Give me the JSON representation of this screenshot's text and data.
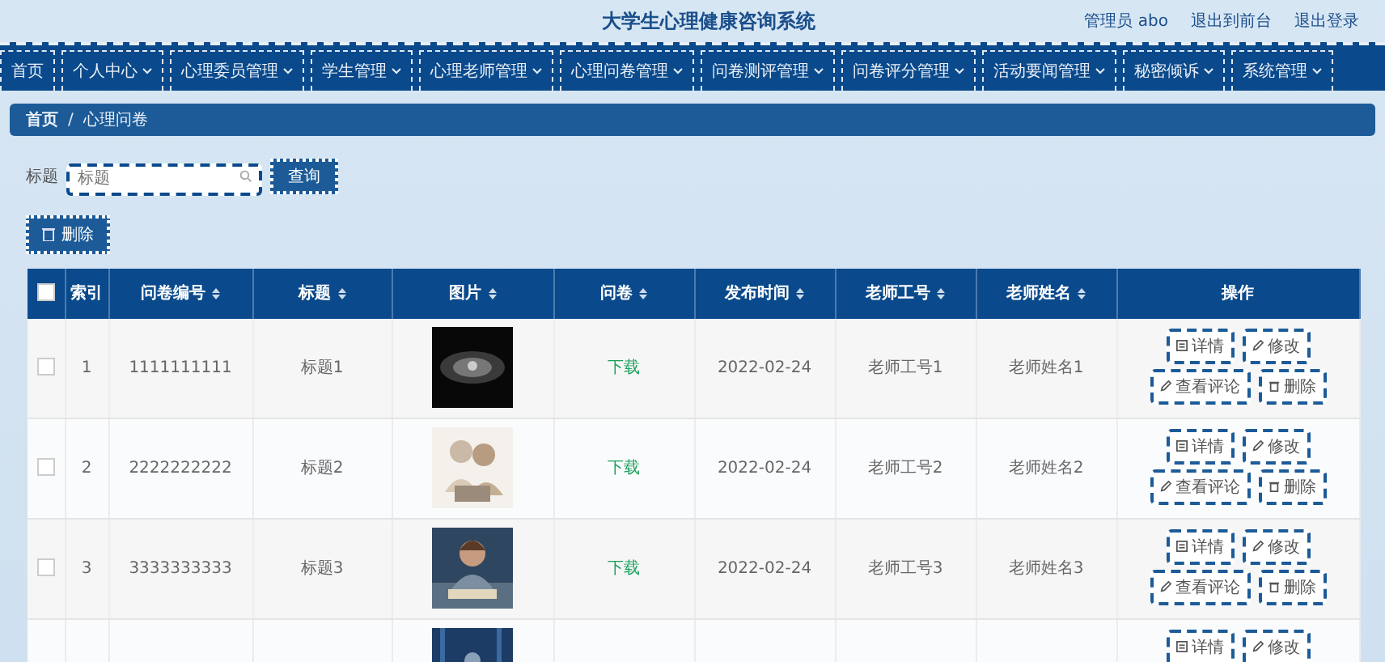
{
  "header": {
    "title": "大学生心理健康咨询系统",
    "user": "管理员 abo",
    "links": [
      "退出到前台",
      "退出登录"
    ]
  },
  "nav": [
    {
      "label": "首页",
      "dropdown": false
    },
    {
      "label": "个人中心",
      "dropdown": true
    },
    {
      "label": "心理委员管理",
      "dropdown": true
    },
    {
      "label": "学生管理",
      "dropdown": true
    },
    {
      "label": "心理老师管理",
      "dropdown": true
    },
    {
      "label": "心理问卷管理",
      "dropdown": true
    },
    {
      "label": "问卷测评管理",
      "dropdown": true
    },
    {
      "label": "问卷评分管理",
      "dropdown": true
    },
    {
      "label": "活动要闻管理",
      "dropdown": true
    },
    {
      "label": "秘密倾诉",
      "dropdown": true
    },
    {
      "label": "系统管理",
      "dropdown": true
    }
  ],
  "breadcrumb": [
    "首页",
    "/",
    "心理问卷"
  ],
  "search": {
    "label": "标题",
    "placeholder": "标题",
    "button": "查询"
  },
  "delete_button": "删除",
  "table": {
    "header_checked": false,
    "columns": [
      {
        "label": "索引",
        "sortable": false
      },
      {
        "label": "问卷编号",
        "sortable": true
      },
      {
        "label": "标题",
        "sortable": true
      },
      {
        "label": "图片",
        "sortable": true
      },
      {
        "label": "问卷",
        "sortable": true
      },
      {
        "label": "发布时间",
        "sortable": true
      },
      {
        "label": "老师工号",
        "sortable": true
      },
      {
        "label": "老师姓名",
        "sortable": true
      },
      {
        "label": "操作",
        "sortable": false
      }
    ],
    "rows": [
      {
        "checked": false,
        "index": "1",
        "code": "1111111111",
        "title": "标题1",
        "picture": {
          "kind": "dark"
        },
        "file": "下载",
        "date": "2022-02-24",
        "teacher_id": "老师工号1",
        "teacher_name": "老师姓名1",
        "actions": [
          "详情",
          "修改",
          "查看评论",
          "删除"
        ]
      },
      {
        "checked": false,
        "index": "2",
        "code": "2222222222",
        "title": "标题2",
        "picture": {
          "kind": "sketch"
        },
        "file": "下载",
        "date": "2022-02-24",
        "teacher_id": "老师工号2",
        "teacher_name": "老师姓名2",
        "actions": [
          "详情",
          "修改",
          "查看评论",
          "删除"
        ]
      },
      {
        "checked": false,
        "index": "3",
        "code": "3333333333",
        "title": "标题3",
        "picture": {
          "kind": "person"
        },
        "file": "下载",
        "date": "2022-02-24",
        "teacher_id": "老师工号3",
        "teacher_name": "老师姓名3",
        "actions": [
          "详情",
          "修改",
          "查看评论",
          "删除"
        ]
      },
      {
        "picture": {
          "kind": "hood"
        },
        "actions": [
          "详情",
          "修改"
        ]
      }
    ]
  }
}
